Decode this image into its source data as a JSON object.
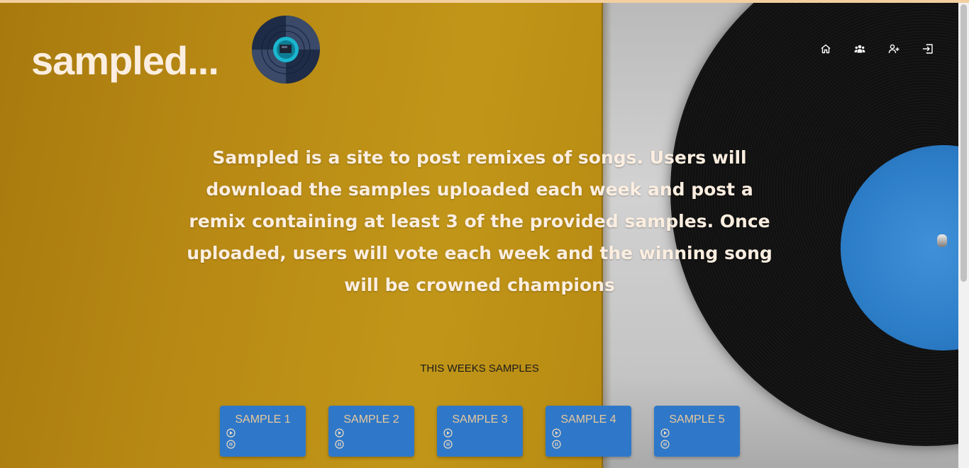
{
  "header": {
    "site_title": "sampled...",
    "logo_icon": "vinyl-record-logo",
    "nav": [
      {
        "id": "home",
        "icon": "home-icon"
      },
      {
        "id": "users",
        "icon": "users-group-icon"
      },
      {
        "id": "register",
        "icon": "user-add-icon"
      },
      {
        "id": "login",
        "icon": "login-icon"
      }
    ]
  },
  "main": {
    "description": "Sampled is a site to post remixes of songs. Users will download the samples uploaded each week and post a remix containing at least 3 of the provided samples. Once uploaded, users will vote each week and the winning song will be crowned champions",
    "samples_heading": "THIS WEEKS SAMPLES",
    "samples": [
      {
        "label": "SAMPLE 1"
      },
      {
        "label": "SAMPLE 2"
      },
      {
        "label": "SAMPLE 3"
      },
      {
        "label": "SAMPLE 4"
      },
      {
        "label": "SAMPLE 5"
      }
    ]
  },
  "colors": {
    "accent": "#2f78c9",
    "title_text": "#fbeee0",
    "sample_label": "#e8c89c",
    "background": "#b8870f"
  },
  "icons": {
    "play": "play-circle-icon",
    "pause": "pause-circle-icon"
  }
}
